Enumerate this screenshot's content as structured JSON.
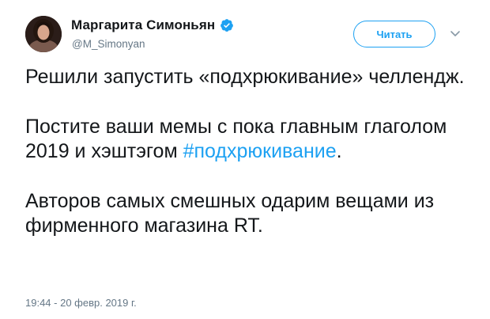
{
  "author": {
    "display_name": "Маргарита Симоньян",
    "handle": "@M_Simonyan",
    "verified": true
  },
  "actions": {
    "follow_label": "Читать"
  },
  "tweet": {
    "paragraph1": "Решили запустить «подхрюкивание» челлендж.",
    "paragraph2_before": "Постите ваши мемы с пока главным глаголом 2019 и хэштэгом ",
    "hashtag": "#подхрюкивание",
    "paragraph2_after": ".",
    "paragraph3": "Авторов самых смешных одарим вещами из фирменного магазина RT.",
    "timestamp": "19:44 - 20 февр. 2019 г."
  },
  "colors": {
    "accent": "#1da1f2",
    "text": "#14171a",
    "secondary": "#657786"
  },
  "icons": {
    "verified": "verified-badge-icon",
    "menu": "chevron-down-icon"
  }
}
